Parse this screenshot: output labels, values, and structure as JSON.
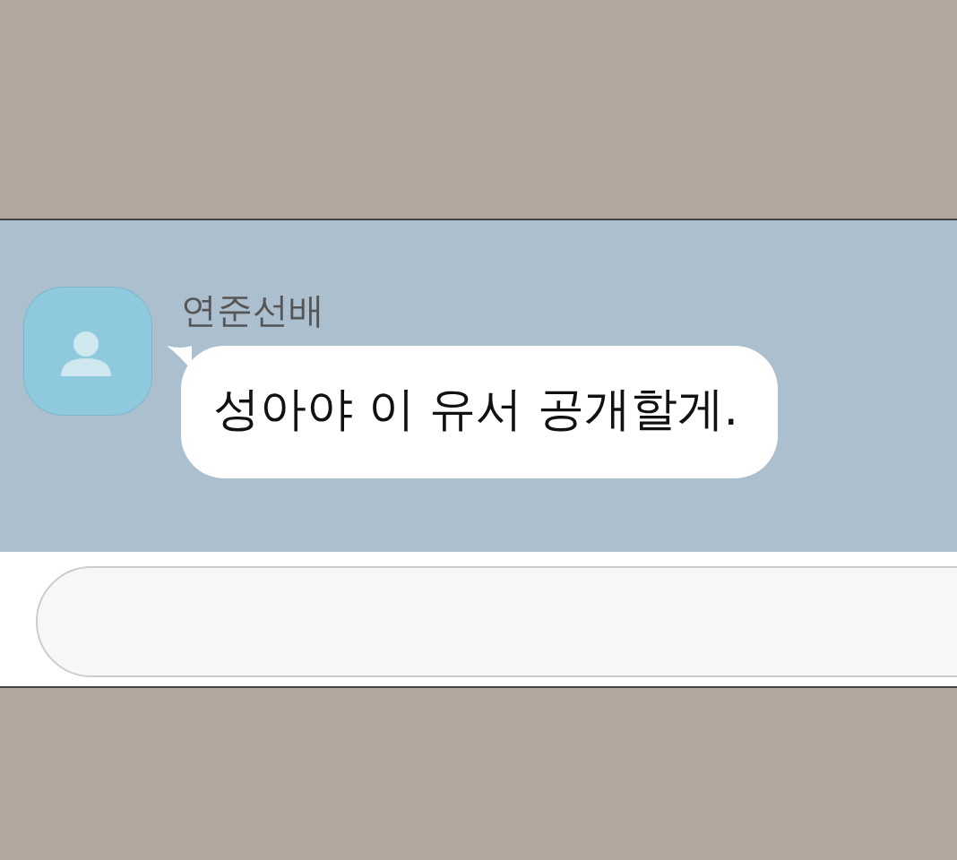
{
  "chat": {
    "messages": [
      {
        "sender": "연준선배",
        "text": "성아야 이 유서 공개할게."
      }
    ]
  }
}
